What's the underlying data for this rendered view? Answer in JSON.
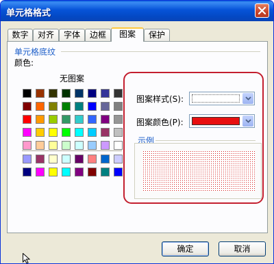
{
  "window": {
    "title": "单元格格式"
  },
  "tabs": [
    "数字",
    "对齐",
    "字体",
    "边框",
    "图案",
    "保护"
  ],
  "active_tab": "图案",
  "shading": {
    "group_caption": "单元格底纹",
    "color_label": "颜色:",
    "none_label": "无图案",
    "palette_main": [
      [
        "#000000",
        "#993300",
        "#333300",
        "#003300",
        "#003366",
        "#000080",
        "#333399",
        "#333333"
      ],
      [
        "#800000",
        "#FF6600",
        "#808000",
        "#008000",
        "#008080",
        "#0000FF",
        "#666699",
        "#808080"
      ],
      [
        "#FF0000",
        "#FF9900",
        "#99CC00",
        "#339966",
        "#33CCCC",
        "#3366FF",
        "#800080",
        "#969696"
      ],
      [
        "#FF00FF",
        "#FFCC00",
        "#FFFF00",
        "#00FF00",
        "#00FFFF",
        "#00CCFF",
        "#993366",
        "#C0C0C0"
      ],
      [
        "#FF99CC",
        "#FFCC99",
        "#FFFF99",
        "#CCFFCC",
        "#CCFFFF",
        "#99CCFF",
        "#CC99FF",
        "#FFFFFF"
      ]
    ],
    "palette_extra": [
      [
        "#9999FF",
        "#993366",
        "#FFFFCC",
        "#CCFFFF",
        "#660066",
        "#FF8080",
        "#0066CC",
        "#CCCCFF"
      ],
      [
        "#000080",
        "#FF00FF",
        "#FFFF00",
        "#00FFFF",
        "#800080",
        "#800000",
        "#008080",
        "#0000FF"
      ]
    ]
  },
  "pattern": {
    "style_label": "图案样式(S):",
    "color_label": "图案颜色(P):",
    "color_value": "#E81010"
  },
  "sample": {
    "caption": "示例"
  },
  "buttons": {
    "ok": "确定",
    "cancel": "取消"
  }
}
